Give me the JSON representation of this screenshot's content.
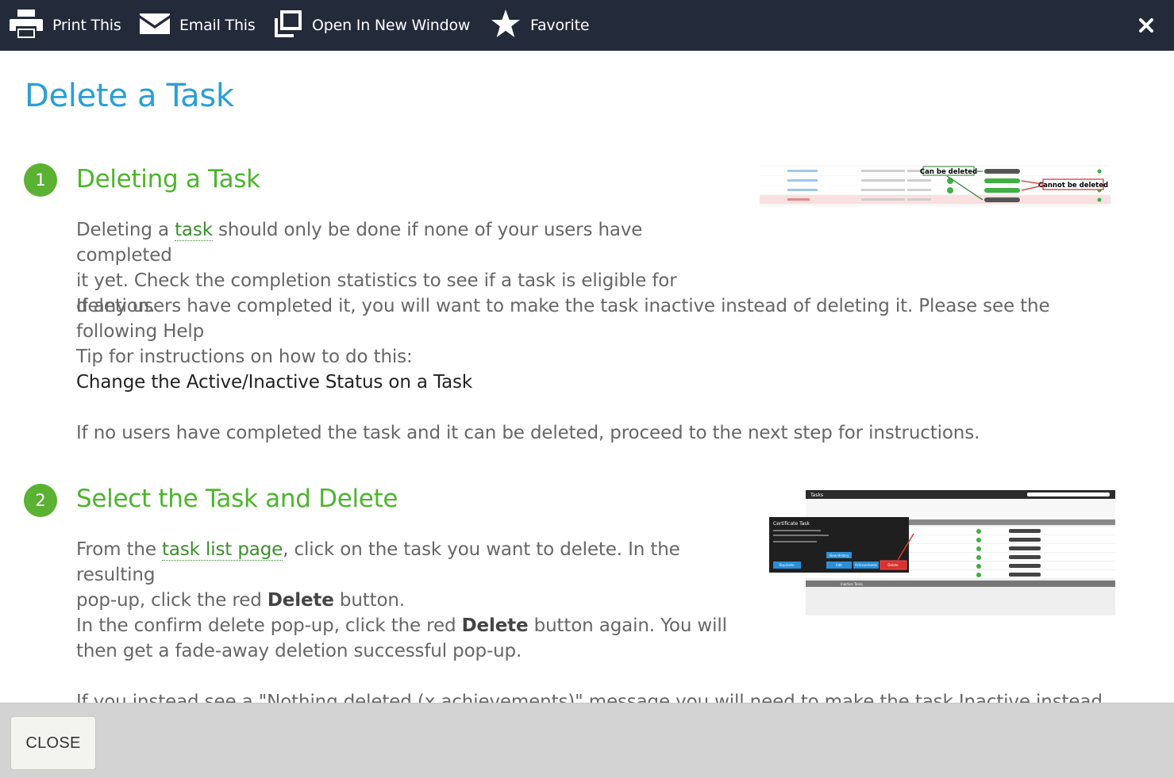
{
  "toolbar": {
    "print_label": "Print This",
    "email_label": "Email This",
    "open_window_label": "Open In New Window",
    "favorite_label": "Favorite",
    "close_glyph": "×"
  },
  "page": {
    "title": "Delete a Task"
  },
  "steps": [
    {
      "number": "1",
      "title": "Deleting a Task",
      "p1_pre": "Deleting a ",
      "p1_link": "task",
      "p1_post_line1": " should only be done if none of your users have completed",
      "p1_line2": "it yet. Check the completion statistics to see if a task is eligible for deletion.",
      "p2_line1": "If any users have completed it, you will want to make the task inactive instead of deleting it. Please see the following Help",
      "p2_line2": "Tip for instructions on how to do this:",
      "help_tip": "Change the Active/Inactive Status on a Task",
      "p3": "If no users have completed the task and it can be deleted, proceed to the next step for instructions.",
      "screenshot": {
        "callout_can": "Can be deleted",
        "callout_cannot": "Cannot be deleted"
      }
    },
    {
      "number": "2",
      "title": "Select the Task and Delete",
      "p1_pre": "From the ",
      "p1_link": "task list page",
      "p1_post_line1": ", click on the task you want to delete. In the resulting",
      "p1_line2_pre": "pop-up, click the red ",
      "p1_line2_bold": "Delete",
      "p1_line2_post": " button.",
      "p2_line1_pre": "In the confirm delete pop-up, click the red ",
      "p2_line1_bold": "Delete",
      "p2_line1_post": " button again. You will",
      "p2_line2": "then get a fade-away deletion successful pop-up.",
      "p3_partial": "If you instead see a \"Nothing deleted (x achievements)\" message you will need to make the task Inactive instead.",
      "screenshot": {
        "app_title": "Tasks",
        "popup_title": "Certificate Task",
        "btn_delete": "Delete",
        "btn_duplicate": "Duplicate",
        "btn_edit": "Edit",
        "btn_view_history": "View History",
        "btn_achievements": "Achievements",
        "inactive_tasks": "Inactive Tasks"
      }
    }
  ],
  "footer": {
    "close_label": "CLOSE"
  },
  "colors": {
    "topbar": "#232a3a",
    "title_blue": "#2a9fd6",
    "step_green": "#4cb52c",
    "link_green": "#3c8d2e",
    "body_text": "#666666",
    "footer": "#d3d3d3"
  }
}
